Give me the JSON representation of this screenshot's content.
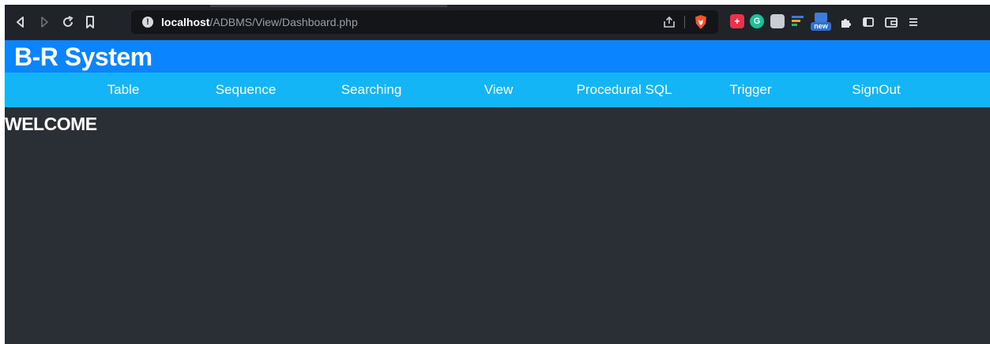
{
  "browser": {
    "url_host": "localhost",
    "url_path": "/ADBMS/View/Dashboard.php",
    "extension_badge": "new"
  },
  "header": {
    "brand": "B-R System"
  },
  "menu": {
    "items": [
      {
        "label": "Table"
      },
      {
        "label": "Sequence"
      },
      {
        "label": "Searching"
      },
      {
        "label": "View"
      },
      {
        "label": "Procedural SQL"
      },
      {
        "label": "Trigger"
      },
      {
        "label": "SignOut"
      }
    ]
  },
  "main": {
    "welcome": "WELCOME"
  },
  "colors": {
    "page_background": "#292f35",
    "brand_bar": "#0a85ff",
    "menu_bar": "#14b5f7",
    "toolbar": "#202327"
  },
  "icons": [
    "back-icon",
    "forward-icon",
    "reload-icon",
    "bookmark-icon",
    "info-icon",
    "share-icon",
    "brave-shield-icon",
    "extensions-icon",
    "sidebar-icon",
    "wallet-icon",
    "menu-icon"
  ]
}
